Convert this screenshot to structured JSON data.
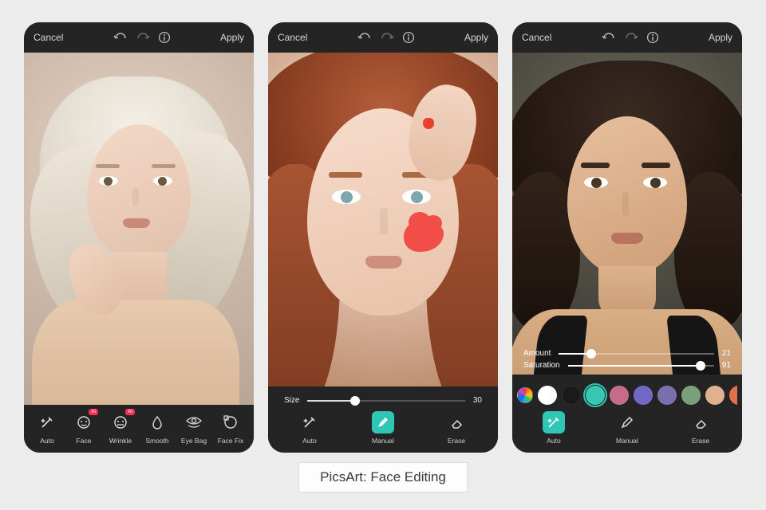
{
  "caption": "PicsArt: Face Editing",
  "topbar": {
    "cancel": "Cancel",
    "apply": "Apply"
  },
  "phones": [
    {
      "tools": [
        {
          "label": "Auto",
          "icon": "sparkle"
        },
        {
          "label": "Face",
          "icon": "face",
          "badge": "AI"
        },
        {
          "label": "Wrinkle",
          "icon": "wrinkle",
          "badge": "AI"
        },
        {
          "label": "Smooth",
          "icon": "drop"
        },
        {
          "label": "Eye Bag",
          "icon": "eyebag"
        },
        {
          "label": "Face Fix",
          "icon": "facefix"
        }
      ]
    },
    {
      "size_slider": {
        "label": "Size",
        "value": 30,
        "min": 0,
        "max": 100
      },
      "tools": [
        {
          "label": "Auto",
          "icon": "sparkle"
        },
        {
          "label": "Manual",
          "icon": "brush",
          "selected": true
        },
        {
          "label": "Erase",
          "icon": "eraser"
        }
      ]
    },
    {
      "sliders": [
        {
          "label": "Amount",
          "value": 21,
          "min": 0,
          "max": 100
        },
        {
          "label": "Saturation",
          "value": 91,
          "min": 0,
          "max": 100
        }
      ],
      "swatches": [
        "wheel",
        "#ffffff",
        "#1a1a1a",
        "#39c6b3",
        "#c86b8b",
        "#6f68c6",
        "#7a6fae",
        "#7aa07a",
        "#e0b18f",
        "#e0704a"
      ],
      "swatch_selected": 3,
      "tools": [
        {
          "label": "Auto",
          "icon": "sparkle",
          "selected": true
        },
        {
          "label": "Manual",
          "icon": "brush"
        },
        {
          "label": "Erase",
          "icon": "eraser"
        }
      ]
    }
  ],
  "colors": {
    "accent": "#2fc6b5",
    "toolbar": "#242424",
    "phone_bg": "#1e1e1e"
  }
}
